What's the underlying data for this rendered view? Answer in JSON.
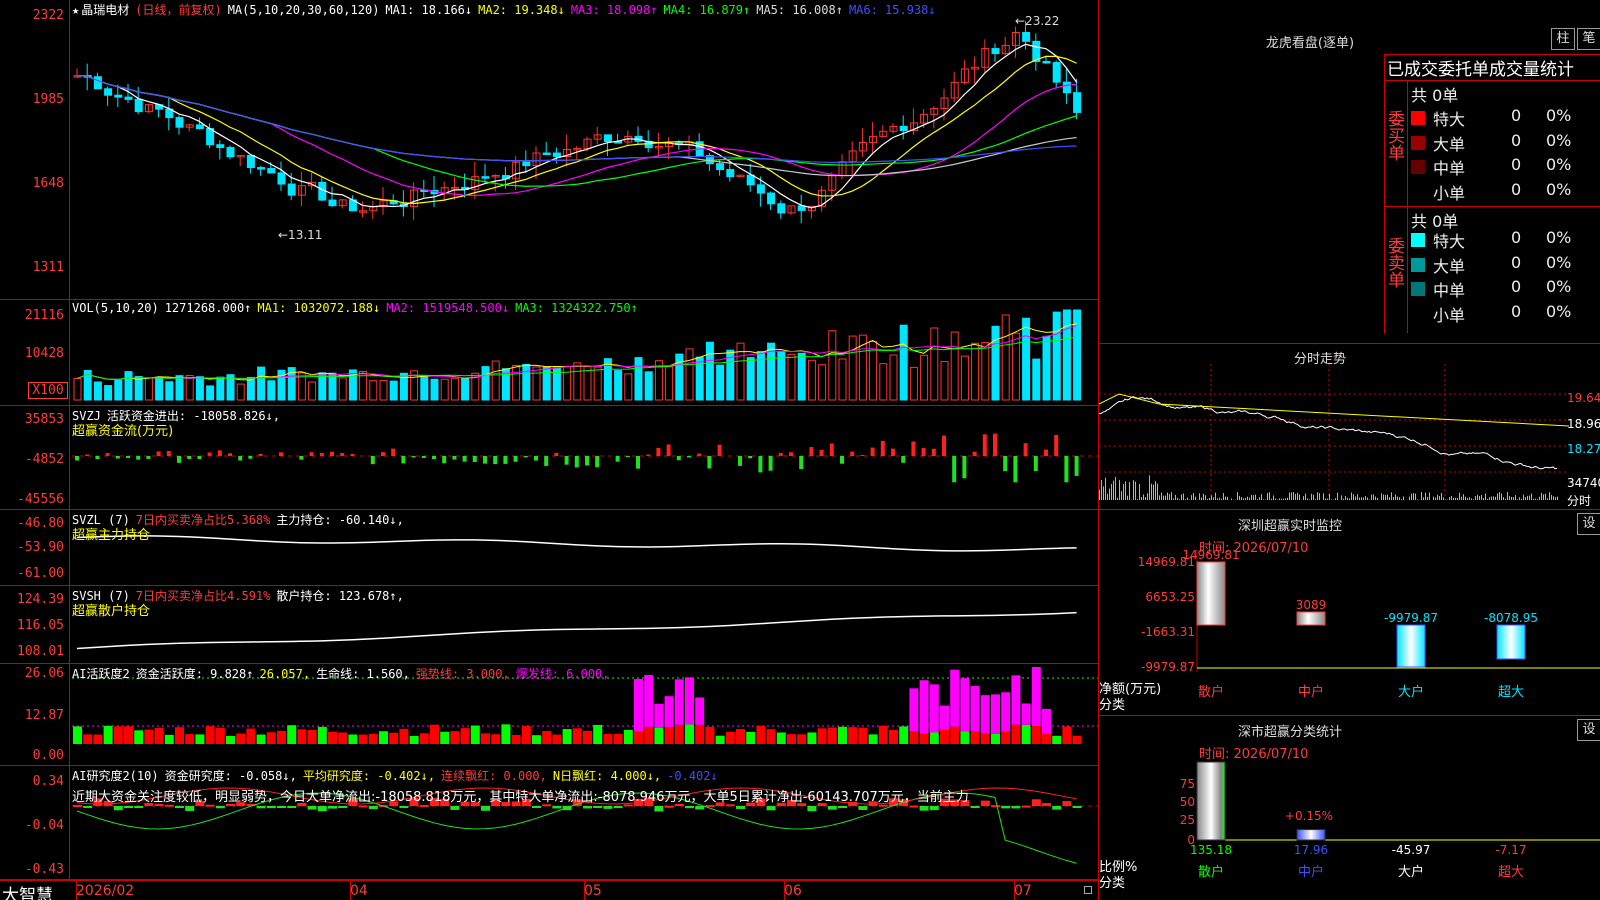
{
  "app": {
    "brand": "大智慧"
  },
  "main": {
    "y_ticks": [
      "2322",
      "1985",
      "1648",
      "1311"
    ],
    "header": {
      "star": "★",
      "stock": "晶瑞电材",
      "mode": "(日线，前复权)",
      "ma_def": "MA(5,10,20,30,60,120)",
      "ma1": "MA1: 18.166↓",
      "ma2": "MA2: 19.348↓",
      "ma3": "MA3: 18.098↑",
      "ma4": "MA4: 16.879↑",
      "ma5": "MA5: 16.008↑",
      "ma6": "MA6: 15.938↓"
    },
    "high_label": "←23.22",
    "low_label": "←13.11",
    "colors": {
      "up": "#ff3232",
      "down": "#00e5ff",
      "ma1": "#ffffff",
      "ma2": "#ffff00",
      "ma3": "#ff00ff",
      "ma4": "#00ff00",
      "ma5": "#c8c8c8",
      "ma6": "#3c50ff"
    }
  },
  "vol": {
    "y_ticks": [
      "21116",
      "10428",
      "X100"
    ],
    "header": {
      "def": "VOL(5,10,20)",
      "v": "1271268.000↑",
      "ma1": "MA1: 1032072.188↓",
      "ma2": "MA2: 1519548.500↓",
      "ma3": "MA3: 1324322.750↑"
    }
  },
  "svzj": {
    "y_ticks": [
      "35853",
      "-4852",
      "-45556"
    ],
    "header": {
      "def": "SVZJ",
      "label": "活跃资金进出: -18058.826↓,"
    },
    "title2": "超赢资金流(万元)"
  },
  "svzl": {
    "y_ticks": [
      "-46.80",
      "-53.90",
      "-61.00"
    ],
    "header": {
      "def": "SVZL (7)",
      "label": "7日内买卖净占比5.368%",
      "label2": "主力持仓: -60.140↓,"
    },
    "title2": "超赢主力持仓"
  },
  "svsh": {
    "y_ticks": [
      "124.39",
      "116.05",
      "108.01"
    ],
    "header": {
      "def": "SVSH (7)",
      "label": "7日内买卖净占比4.591%",
      "label2": "散户持仓: 123.678↑,"
    },
    "title2": "超赢散户持仓"
  },
  "ai1": {
    "y_ticks": [
      "26.06",
      "12.87",
      "0.00"
    ],
    "header": {
      "def": "AI活跃度2",
      "a": "资金活跃度: 9.828↑",
      "b": "26.057,",
      "c": "生命线: 1.560,",
      "d": "强势线: 3.000,",
      "e": "爆发线: 6.000,"
    }
  },
  "ai2": {
    "y_ticks": [
      "0.34",
      "-0.04",
      "-0.43"
    ],
    "header": {
      "def": "AI研究度2(10)",
      "a": "资金研究度: -0.058↓,",
      "b": "平均研究度: -0.402↓,",
      "c": "连续飘红: 0.000,",
      "d": "N日飘红: 4.000↓,",
      "e": "-0.402↓"
    },
    "commentary": "近期大资金关注度较低，明显弱势，今日大单净流出:-18058.818万元，其中特大单净流出:-8078.946万元，大单5日累计净出-60143.707万元，当前主力"
  },
  "xaxis": {
    "labels": [
      "2026/02",
      "04",
      "05",
      "06",
      "07"
    ]
  },
  "dragon": {
    "title": "龙虎看盘(逐单)",
    "btn_a": "柱",
    "btn_b": "笔",
    "tab_label": "已成交委托单成交量统计",
    "buy_label": "委买单",
    "sell_label": "委卖单",
    "buy_total": "共 0单",
    "sell_total": "共 0单",
    "buy_rows": [
      {
        "name": "特大",
        "count": "0",
        "pct": "0%",
        "color": "#ff0000"
      },
      {
        "name": "大单",
        "count": "0",
        "pct": "0%",
        "color": "#990000"
      },
      {
        "name": "中单",
        "count": "0",
        "pct": "0%",
        "color": "#660000"
      },
      {
        "name": "小单",
        "count": "0",
        "pct": "0%",
        "color": "#000000"
      }
    ],
    "sell_rows": [
      {
        "name": "特大",
        "count": "0",
        "pct": "0%",
        "color": "#00ffff"
      },
      {
        "name": "大单",
        "count": "0",
        "pct": "0%",
        "color": "#009999"
      },
      {
        "name": "中单",
        "count": "0",
        "pct": "0%",
        "color": "#007777"
      },
      {
        "name": "小单",
        "count": "0",
        "pct": "0%",
        "color": "#000000"
      }
    ]
  },
  "minute": {
    "title": "分时走势",
    "y_ticks": [
      "19.64",
      "18.96",
      "18.27",
      "34740"
    ],
    "footer": "分时"
  },
  "sz_monitor": {
    "title": "深圳超赢实时监控",
    "settings": "设",
    "time": "时间: 2026/07/10",
    "y_ticks": [
      "14969.81",
      "6653.25",
      "-1663.31",
      "-9979.87"
    ],
    "unit": "净额(万元)",
    "cat_label": "分类",
    "categories": [
      "散户",
      "中户",
      "大户",
      "超大"
    ],
    "values": [
      "14969.81",
      "3089",
      "-9979.87",
      "-8078.95"
    ]
  },
  "sz_class": {
    "title": "深市超赢分类统计",
    "settings": "设",
    "time": "时间: 2026/07/10",
    "y_ticks": [
      "75",
      "50",
      "25",
      "0"
    ],
    "ratio_label": "比例%",
    "cat_label": "分类",
    "annotation": "+0.15%",
    "categories": [
      "散户",
      "中户",
      "大户",
      "超大"
    ],
    "values": [
      "135.18",
      "17.96",
      "-45.97",
      "-7.17"
    ]
  }
}
